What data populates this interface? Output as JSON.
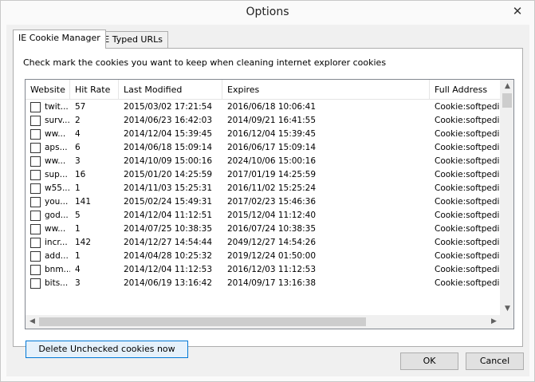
{
  "window": {
    "title": "Options",
    "close_glyph": "✕"
  },
  "tabs": [
    {
      "label": "IE Cookie Manager",
      "active": true
    },
    {
      "label": "IE Typed URLs",
      "active": false
    }
  ],
  "instructions": "Check mark the cookies you want to keep when cleaning internet explorer cookies",
  "table": {
    "columns": [
      "Website",
      "Hit Rate",
      "Last Modified",
      "Expires",
      "Full Address"
    ],
    "rows": [
      {
        "website": "twit...",
        "hit_rate": "57",
        "last_modified": "2015/03/02 17:21:54",
        "expires": "2016/06/18 10:06:41",
        "full_address": "Cookie:softpedia"
      },
      {
        "website": "surv...",
        "hit_rate": "2",
        "last_modified": "2014/06/23 16:42:03",
        "expires": "2014/09/21 16:41:55",
        "full_address": "Cookie:softpedia"
      },
      {
        "website": "ww...",
        "hit_rate": "4",
        "last_modified": "2014/12/04 15:39:45",
        "expires": "2016/12/04 15:39:45",
        "full_address": "Cookie:softpedia"
      },
      {
        "website": "aps...",
        "hit_rate": "6",
        "last_modified": "2014/06/18 15:09:14",
        "expires": "2016/06/17 15:09:14",
        "full_address": "Cookie:softpedia"
      },
      {
        "website": "ww...",
        "hit_rate": "3",
        "last_modified": "2014/10/09 15:00:16",
        "expires": "2024/10/06 15:00:16",
        "full_address": "Cookie:softpedia"
      },
      {
        "website": "sup...",
        "hit_rate": "16",
        "last_modified": "2015/01/20 14:25:59",
        "expires": "2017/01/19 14:25:59",
        "full_address": "Cookie:softpedia"
      },
      {
        "website": "w55...",
        "hit_rate": "1",
        "last_modified": "2014/11/03 15:25:31",
        "expires": "2016/11/02 15:25:24",
        "full_address": "Cookie:softpedia"
      },
      {
        "website": "you...",
        "hit_rate": "141",
        "last_modified": "2015/02/24 15:49:31",
        "expires": "2017/02/23 15:46:36",
        "full_address": "Cookie:softpedia"
      },
      {
        "website": "god...",
        "hit_rate": "5",
        "last_modified": "2014/12/04 11:12:51",
        "expires": "2015/12/04 11:12:40",
        "full_address": "Cookie:softpedia"
      },
      {
        "website": "ww...",
        "hit_rate": "1",
        "last_modified": "2014/07/25 10:38:35",
        "expires": "2016/07/24 10:38:35",
        "full_address": "Cookie:softpedia"
      },
      {
        "website": "incr...",
        "hit_rate": "142",
        "last_modified": "2014/12/27 14:54:44",
        "expires": "2049/12/27 14:54:26",
        "full_address": "Cookie:softpedia"
      },
      {
        "website": "add...",
        "hit_rate": "1",
        "last_modified": "2014/04/28 10:25:32",
        "expires": "2019/12/24 01:50:00",
        "full_address": "Cookie:softpedia"
      },
      {
        "website": "bnm...",
        "hit_rate": "4",
        "last_modified": "2014/12/04 11:12:53",
        "expires": "2016/12/03 11:12:53",
        "full_address": "Cookie:softpedia"
      },
      {
        "website": "bits...",
        "hit_rate": "3",
        "last_modified": "2014/06/19 13:16:42",
        "expires": "2014/09/17 13:16:38",
        "full_address": "Cookie:softpedia"
      }
    ]
  },
  "buttons": {
    "delete": "Delete Unchecked cookies now",
    "ok": "OK",
    "cancel": "Cancel"
  },
  "scroll_glyphs": {
    "up": "▲",
    "down": "▼",
    "left": "◀",
    "right": "▶"
  }
}
